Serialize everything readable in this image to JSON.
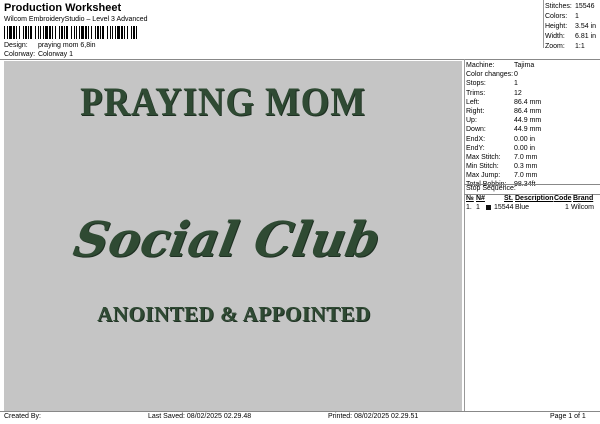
{
  "header": {
    "title": "Production Worksheet",
    "subtitle": "Wilcom EmbroideryStudio – Level 3 Advanced",
    "design_label": "Design:",
    "design_value": "praying mom 6,8in",
    "colorway_label": "Colorway:",
    "colorway_value": "Colorway 1"
  },
  "stats": [
    {
      "label": "Stitches:",
      "value": "15546"
    },
    {
      "label": "Colors:",
      "value": "1"
    },
    {
      "label": "Height:",
      "value": "3.54 in"
    },
    {
      "label": "Width:",
      "value": "6.81 in"
    },
    {
      "label": "Zoom:",
      "value": "1:1"
    }
  ],
  "design": {
    "line1": "PRAYING MOM",
    "line2": "Social Club",
    "line3": "ANOINTED & APPOINTED",
    "thread_color": "#2f4a33",
    "background_color": "#c5c5c5"
  },
  "machine": [
    {
      "label": "Machine:",
      "value": "Tajima"
    },
    {
      "label": "Color changes:",
      "value": "0"
    },
    {
      "label": "Stops:",
      "value": "1"
    },
    {
      "label": "Trims:",
      "value": "12"
    },
    {
      "label": "Left:",
      "value": "86.4 mm"
    },
    {
      "label": "Right:",
      "value": "86.4 mm"
    },
    {
      "label": "Up:",
      "value": "44.9 mm"
    },
    {
      "label": "Down:",
      "value": "44.9 mm"
    },
    {
      "label": "EndX:",
      "value": "0.00 in"
    },
    {
      "label": "EndY:",
      "value": "0.00 in"
    },
    {
      "label": "Max Stitch:",
      "value": "7.0 mm"
    },
    {
      "label": "Min Stitch:",
      "value": "0.3 mm"
    },
    {
      "label": "Max Jump:",
      "value": "7.0 mm"
    },
    {
      "label": "Total Bobbin:",
      "value": "98.34ft"
    }
  ],
  "stop_sequence": {
    "heading": "Stop Sequence:",
    "columns": [
      "№",
      "N#",
      "St.",
      "Description",
      "Code",
      "Brand"
    ],
    "rows": [
      {
        "no": "1.",
        "n": "1",
        "st": "15544",
        "description": "Blue",
        "code": "1",
        "brand": "Wilcom",
        "swatch_color": "#111111"
      }
    ]
  },
  "footer": {
    "created_by": "Created By:",
    "last_saved": "Last Saved: 08/02/2025 02.29.48",
    "printed": "Printed: 08/02/2025 02.29.51",
    "page": "Page 1 of 1"
  }
}
